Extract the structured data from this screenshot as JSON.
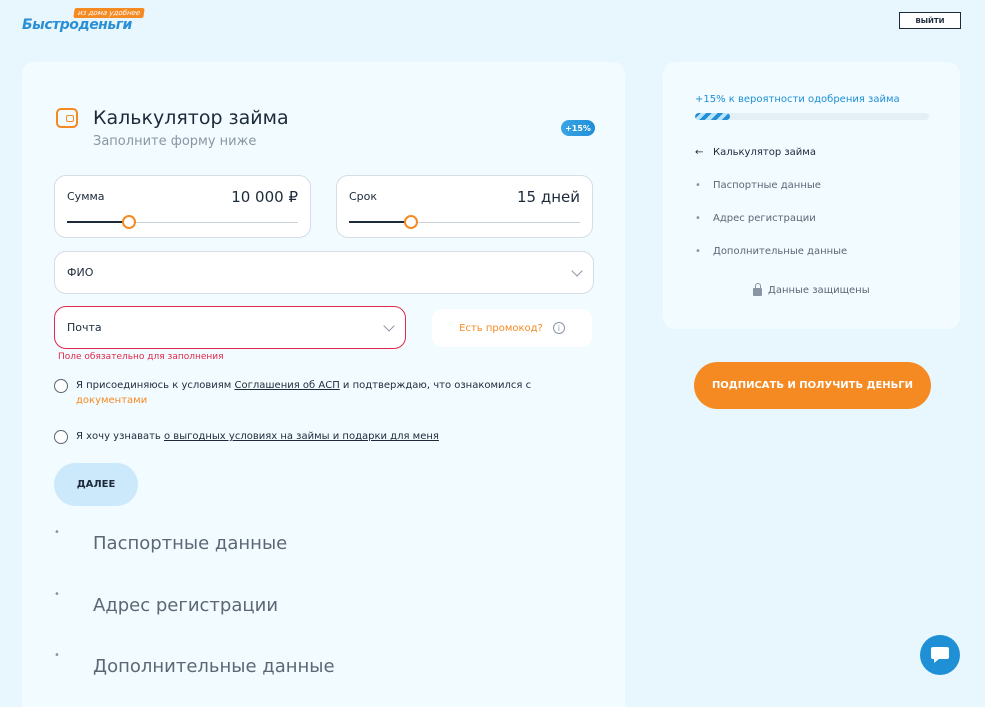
{
  "logo": {
    "tagline": "из дома удобнее",
    "wordmark": "Быстроденьги"
  },
  "header": {
    "logout_label": "ВЫЙТИ"
  },
  "calculator": {
    "title": "Калькулятор займа",
    "subtitle": "Заполните форму ниже",
    "badge": "+15%",
    "amount": {
      "label": "Сумма",
      "value": "10 000 ₽",
      "level": 0.27
    },
    "term": {
      "label": "Срок",
      "value": "15 дней",
      "level": 0.27
    }
  },
  "form": {
    "fio_placeholder": "ФИО",
    "email_placeholder": "Почта",
    "email_error": "Поле обязательно для заполнения",
    "promo_label": "Есть промокод?",
    "promo_info_icon": "i",
    "consent": {
      "prefix": "Я присоединяюсь к условиям ",
      "link1": "Соглашения об АСП",
      "middle": " и подтверждаю, что ознакомился с ",
      "link2": "документами"
    },
    "marketing": {
      "prefix": "Я хочу узнавать ",
      "link": "о выгодных условиях на займы и подарки для меня"
    },
    "next_label": "ДАЛЕЕ"
  },
  "steps": [
    {
      "bullet": "•",
      "label": "Паспортные данные"
    },
    {
      "bullet": "•",
      "label": "Адрес регистрации"
    },
    {
      "bullet": "•",
      "label": "Дополнительные данные"
    }
  ],
  "sidebar": {
    "probability": "+15% к вероятности одобрения займа",
    "progress": 0.15,
    "steps": [
      {
        "marker": "←",
        "label": "Калькулятор займа"
      },
      {
        "marker": "•",
        "label": "Паспортные данные"
      },
      {
        "marker": "•",
        "label": "Адрес регистрации"
      },
      {
        "marker": "•",
        "label": "Дополнительные данные"
      }
    ],
    "secure": "Данные защищены"
  },
  "sign_label": "ПОДПИСАТЬ И ПОЛУЧИТЬ ДЕНЬГИ",
  "colors": {
    "accent": "#f58a23",
    "brand": "#1f8fd6",
    "error": "#e0294a"
  },
  "icons": {
    "calculator": "wallet-icon",
    "lock": "lock-icon",
    "chat": "chat-bubble-icon",
    "chevron": "chevron-down-icon"
  }
}
